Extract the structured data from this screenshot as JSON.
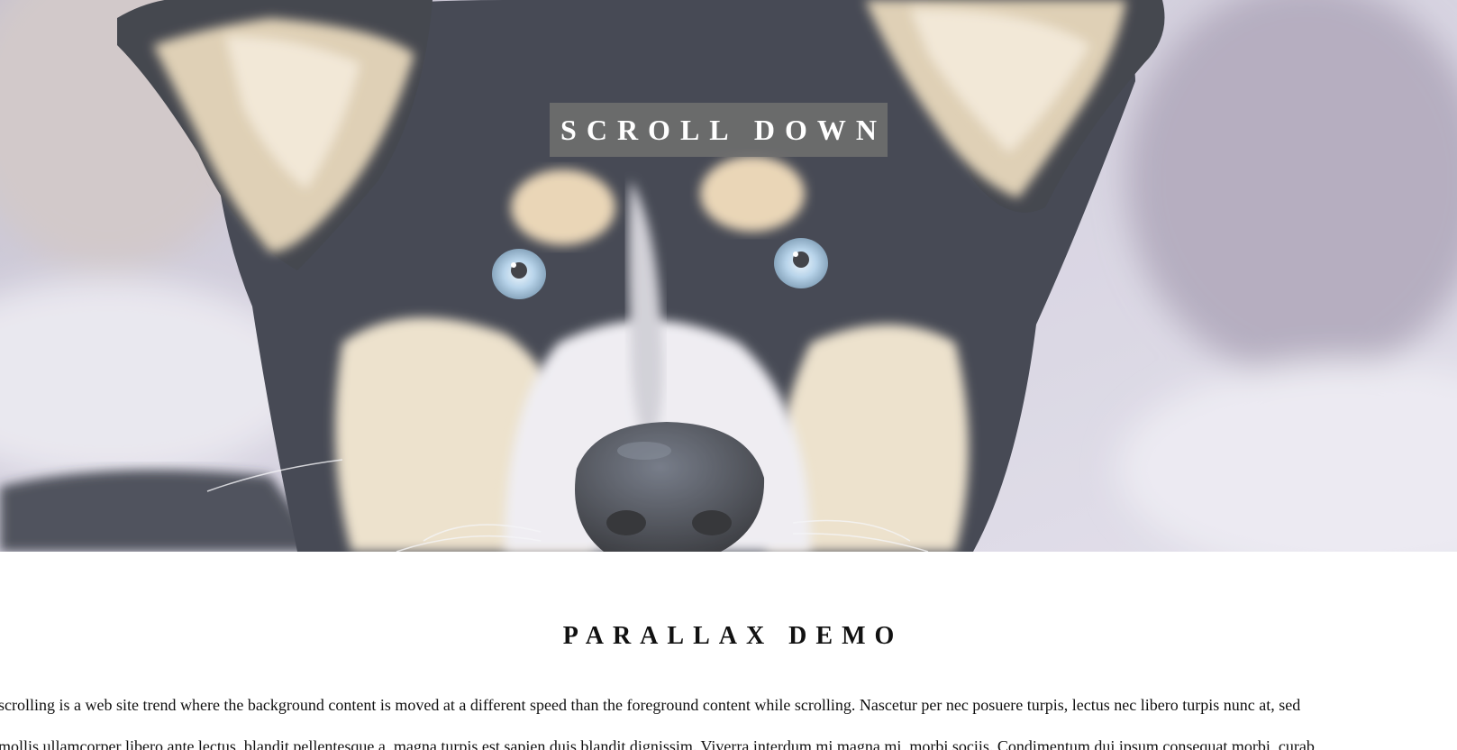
{
  "hero": {
    "caption": "SCROLL DOWN",
    "image_subject": "husky-dog-photo"
  },
  "section": {
    "title": "PARALLAX DEMO",
    "paragraph_lines": [
      "scrolling is a web site trend where the background content is moved at a different speed than the foreground content while scrolling. Nascetur per nec posuere turpis, lectus nec libero turpis nunc at, sed",
      "mollis ullamcorper libero ante lectus, blandit pellentesque a, magna turpis est sapien duis blandit dignissim. Viverra interdum mi magna mi, morbi sociis. Condimentum dui ipsum consequat morbi, curab"
    ]
  },
  "colors": {
    "caption_bg": "#6e6e6e",
    "caption_text": "#ffffff",
    "page_bg": "#ffffff",
    "text": "#111111"
  }
}
